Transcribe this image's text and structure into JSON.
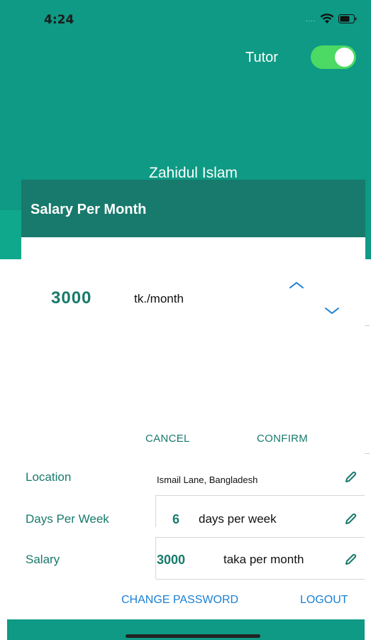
{
  "status_bar": {
    "time": "4:24",
    "dots": "....",
    "wifi_icon": "wifi-icon",
    "battery_icon": "battery-icon"
  },
  "header": {
    "tutor_label": "Tutor",
    "tutor_toggle_on": true,
    "user_name": "Zahidul Islam",
    "background_color": "#0e9a84"
  },
  "dialog": {
    "title": "Salary Per Month",
    "value": "3000",
    "unit": "tk./month",
    "increment_icon": "chevron-up-icon",
    "decrement_icon": "chevron-down-icon",
    "cancel_label": "CANCEL",
    "confirm_label": "CONFIRM",
    "title_bar_color": "#187a6c"
  },
  "profile_rows": [
    {
      "label": "Location",
      "value": "Ismail Lane, Bangladesh",
      "edit_icon": "pencil-icon"
    },
    {
      "label": "Days Per Week",
      "number": "6",
      "unit": "days per week",
      "edit_icon": "pencil-icon"
    },
    {
      "label": "Salary",
      "number": "3000",
      "unit": "taka per month",
      "edit_icon": "pencil-icon"
    }
  ],
  "actions": {
    "change_password_label": "CHANGE PASSWORD",
    "logout_label": "LOGOUT",
    "link_color": "#1a7fd4"
  }
}
